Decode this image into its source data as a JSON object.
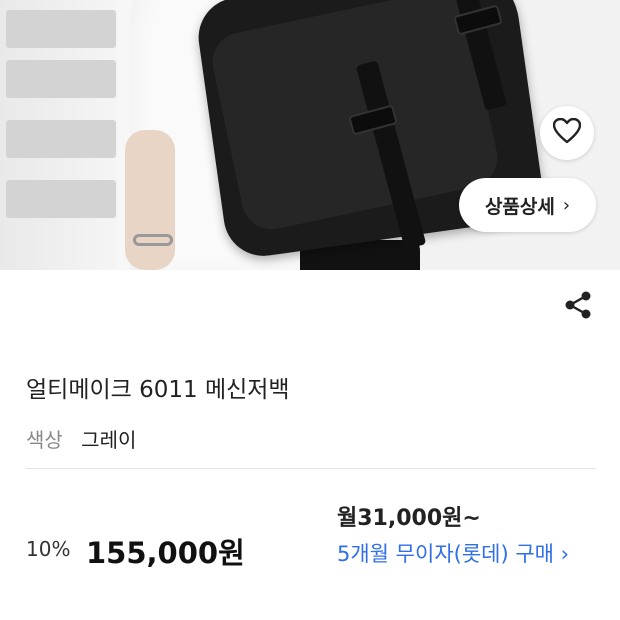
{
  "hero": {
    "image_icon": "product-photo",
    "heart_icon": "heart-outline-icon",
    "detail_button_label": "상품상세",
    "detail_chevron": "›"
  },
  "share_icon": "share-icon",
  "product": {
    "name": "얼티메이크 6011 메신저백",
    "color_label": "색상",
    "color_value": "그레이"
  },
  "pricing": {
    "discount": "10%",
    "price": "155,000원",
    "monthly": "월31,000원~",
    "installment": "5개월 무이자(롯데) 구매 ›"
  },
  "colors": {
    "link_blue": "#2f6fe8",
    "text_dark": "#222222",
    "text_gray": "#888888"
  }
}
